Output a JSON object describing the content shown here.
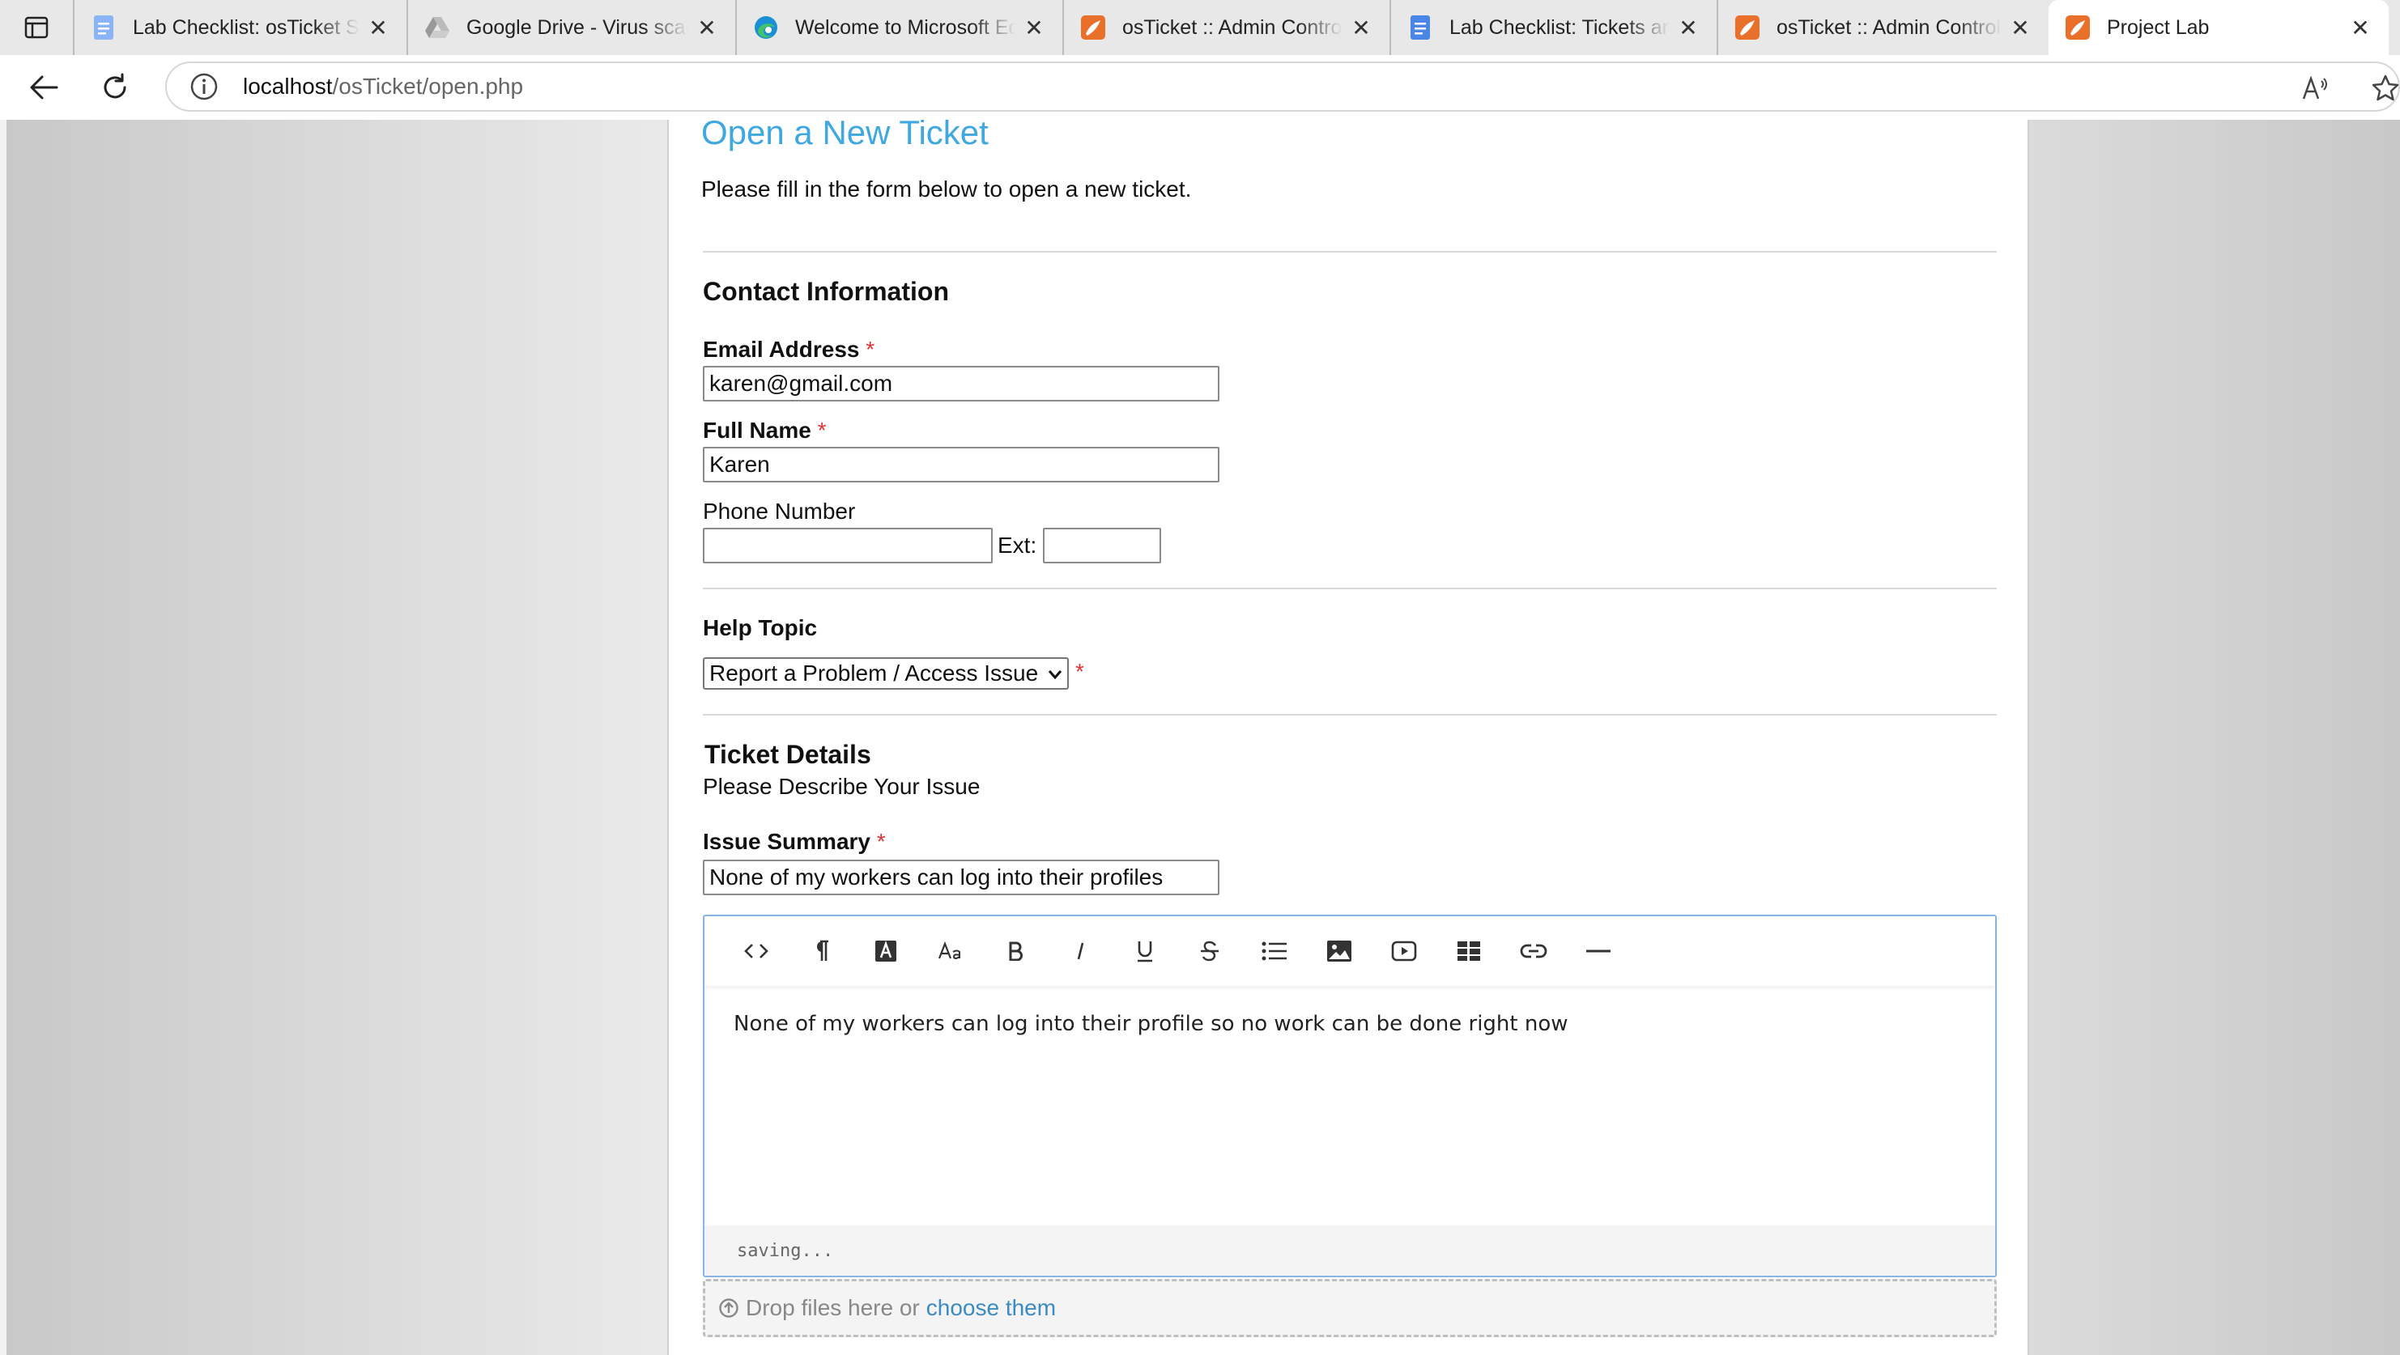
{
  "browser": {
    "tabs": [
      {
        "title": "Lab Checklist: osTicket Setup",
        "icon": "google-docs-icon",
        "active": false
      },
      {
        "title": "Google Drive - Virus scan warning",
        "icon": "google-drive-icon",
        "active": false
      },
      {
        "title": "Welcome to Microsoft Edge",
        "icon": "edge-icon",
        "active": false
      },
      {
        "title": "osTicket :: Admin Control Panel",
        "icon": "osticket-icon",
        "active": false
      },
      {
        "title": "Lab Checklist: Tickets and Tasks",
        "icon": "google-docs-icon",
        "active": false
      },
      {
        "title": "osTicket :: Admin Control Panel",
        "icon": "osticket-icon",
        "active": false
      },
      {
        "title": "Project Lab",
        "icon": "osticket-icon",
        "active": true
      }
    ],
    "url_host": "localhost",
    "url_path": "/osTicket/open.php"
  },
  "page": {
    "title": "Open a New Ticket",
    "intro": "Please fill in the form below to open a new ticket.",
    "contact_heading": "Contact Information",
    "email_label": "Email Address",
    "email_value": "karen@gmail.com",
    "name_label": "Full Name",
    "name_value": "Karen",
    "phone_label": "Phone Number",
    "phone_value": "",
    "ext_label": "Ext:",
    "ext_value": "",
    "help_topic_heading": "Help Topic",
    "help_topic_selected": "Report a Problem / Access Issue",
    "required_mark": "*",
    "details_heading": "Ticket Details",
    "details_sub": "Please Describe Your Issue",
    "summary_label": "Issue Summary",
    "summary_value": "None of my workers can log into their profiles",
    "editor_body": "None of my workers can log into their profile so no work can be done right now",
    "editor_status": "saving...",
    "drop_text": "Drop files here or",
    "drop_link": "choose them"
  },
  "editor_toolbar": [
    "code-view-icon",
    "paragraph-icon",
    "font-color-icon",
    "font-size-icon",
    "bold-icon",
    "italic-icon",
    "underline-icon",
    "strikethrough-icon",
    "list-icon",
    "image-icon",
    "video-icon",
    "table-icon",
    "link-icon",
    "horizontal-rule-icon"
  ],
  "colors": {
    "title_blue": "#3fa8df",
    "link_blue": "#3a8bc2",
    "required_red": "#dd3333",
    "editor_border": "#8ab4e8"
  }
}
